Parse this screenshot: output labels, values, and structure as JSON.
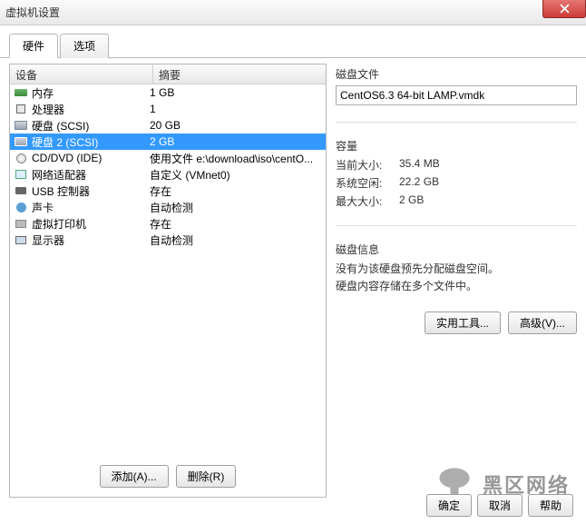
{
  "window": {
    "title": "虚拟机设置"
  },
  "tabs": {
    "hardware": "硬件",
    "options": "选项"
  },
  "columns": {
    "device": "设备",
    "summary": "摘要"
  },
  "devices": [
    {
      "label": "内存",
      "summary": "1 GB",
      "icon": "mem"
    },
    {
      "label": "处理器",
      "summary": "1",
      "icon": "cpu"
    },
    {
      "label": "硬盘 (SCSI)",
      "summary": "20 GB",
      "icon": "hdd"
    },
    {
      "label": "硬盘 2 (SCSI)",
      "summary": "2 GB",
      "icon": "hdd-sel",
      "selected": true
    },
    {
      "label": "CD/DVD (IDE)",
      "summary": "使用文件 e:\\download\\iso\\centO...",
      "icon": "cd"
    },
    {
      "label": "网络适配器",
      "summary": "自定义 (VMnet0)",
      "icon": "net"
    },
    {
      "label": "USB 控制器",
      "summary": "存在",
      "icon": "usb"
    },
    {
      "label": "声卡",
      "summary": "自动检测",
      "icon": "snd"
    },
    {
      "label": "虚拟打印机",
      "summary": "存在",
      "icon": "prn"
    },
    {
      "label": "显示器",
      "summary": "自动检测",
      "icon": "disp"
    }
  ],
  "buttons": {
    "add": "添加(A)...",
    "remove": "删除(R)",
    "util": "实用工具...",
    "adv": "高级(V)...",
    "ok": "确定",
    "cancel": "取消",
    "help": "帮助"
  },
  "disk_file": {
    "title": "磁盘文件",
    "value": "CentOS6.3 64-bit LAMP.vmdk"
  },
  "capacity": {
    "title": "容量",
    "current_label": "当前大小:",
    "current_value": "35.4 MB",
    "free_label": "系统空闲:",
    "free_value": "22.2 GB",
    "max_label": "最大大小:",
    "max_value": "2 GB"
  },
  "disk_info": {
    "title": "磁盘信息",
    "line1": "没有为该硬盘预先分配磁盘空间。",
    "line2": "硬盘内容存储在多个文件中。"
  },
  "watermark": "黑区网络"
}
